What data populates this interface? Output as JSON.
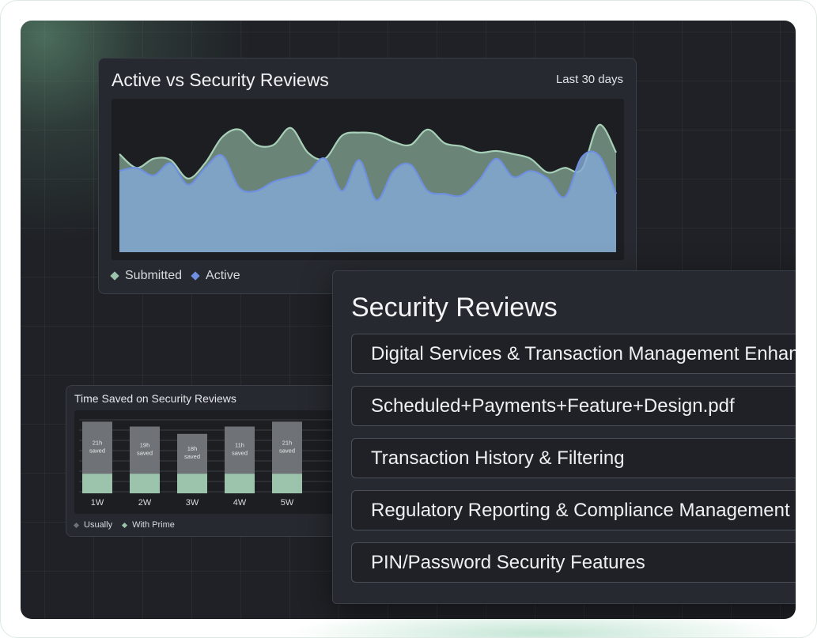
{
  "area_card": {
    "title": "Active vs Security Reviews",
    "range_label": "Last 30 days",
    "legend": [
      {
        "label": "Submitted",
        "color": "#9cc4ac"
      },
      {
        "label": "Active",
        "color": "#6f8fe0"
      }
    ]
  },
  "bar_card": {
    "title": "Time Saved on Security Reviews",
    "legend": [
      {
        "label": "Usually",
        "color": "#6f7377"
      },
      {
        "label": "With Prime",
        "color": "#9cc4ac"
      }
    ]
  },
  "reviews": {
    "title": "Security Reviews",
    "items": [
      "Digital Services & Transaction Management Enhancements",
      "Scheduled+Payments+Feature+Design.pdf",
      "Transaction History & Filtering",
      "Regulatory Reporting & Compliance Management",
      "PIN/Password Security Features"
    ]
  },
  "chart_data": [
    {
      "type": "area",
      "title": "Active vs Security Reviews",
      "xlabel": "",
      "ylabel": "",
      "ylim": [
        0,
        100
      ],
      "x": [
        1,
        2,
        3,
        4,
        5,
        6,
        7,
        8,
        9,
        10,
        11,
        12,
        13,
        14,
        15,
        16,
        17,
        18,
        19,
        20,
        21,
        22,
        23,
        24,
        25,
        26,
        27,
        28,
        29,
        30
      ],
      "grid": false,
      "legend_position": "bottom-left",
      "series": [
        {
          "name": "Submitted",
          "color": "#9cc4ac",
          "values": [
            64,
            55,
            61,
            60,
            48,
            58,
            75,
            80,
            70,
            70,
            81,
            65,
            61,
            76,
            78,
            77,
            72,
            70,
            80,
            71,
            69,
            65,
            66,
            64,
            61,
            52,
            55,
            54,
            83,
            65
          ]
        },
        {
          "name": "Active",
          "color": "#6f8fe0",
          "values": [
            53,
            55,
            50,
            58,
            44,
            55,
            63,
            42,
            40,
            46,
            49,
            52,
            61,
            40,
            60,
            34,
            53,
            57,
            40,
            38,
            37,
            47,
            61,
            49,
            53,
            48,
            36,
            62,
            63,
            38
          ]
        }
      ]
    },
    {
      "type": "bar",
      "title": "Time Saved on Security Reviews",
      "categories": [
        "1W",
        "2W",
        "3W",
        "4W",
        "5W"
      ],
      "ylim": [
        0,
        100
      ],
      "grid": true,
      "legend_position": "bottom-left",
      "series": [
        {
          "name": "Usually",
          "color": "#6f7377",
          "values": [
            88,
            82,
            73,
            82,
            88
          ]
        },
        {
          "name": "With Prime",
          "color": "#9cc4ac",
          "values": [
            24,
            24,
            24,
            24,
            24
          ]
        }
      ],
      "labels": [
        "21h saved",
        "19h saved",
        "18h saved",
        "11h saved",
        "21h saved"
      ]
    }
  ]
}
